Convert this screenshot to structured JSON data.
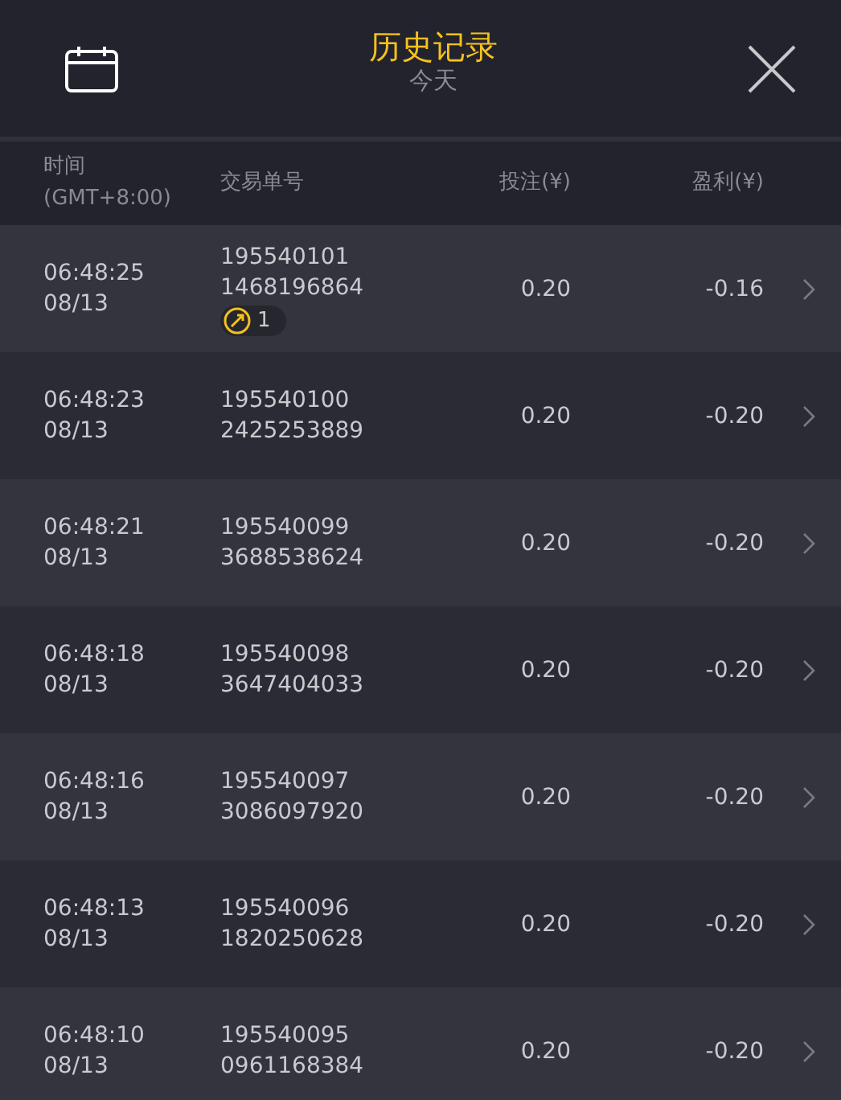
{
  "header": {
    "title": "历史记录",
    "subtitle": "今天"
  },
  "columns": [
    {
      "label": "时间",
      "sublabel": "(GMT+8:00)"
    },
    {
      "label": "交易单号"
    },
    {
      "label": "投注(¥)"
    },
    {
      "label": "盈利(¥)"
    }
  ],
  "rows": [
    {
      "time": "06:48:25",
      "date": "08/13",
      "order_id": "195540101",
      "ref": "1468196864",
      "badge": {
        "count": "1"
      },
      "stake": "0.20",
      "profit": "-0.16"
    },
    {
      "time": "06:48:23",
      "date": "08/13",
      "order_id": "195540100",
      "ref": "2425253889",
      "stake": "0.20",
      "profit": "-0.20"
    },
    {
      "time": "06:48:21",
      "date": "08/13",
      "order_id": "195540099",
      "ref": "3688538624",
      "stake": "0.20",
      "profit": "-0.20"
    },
    {
      "time": "06:48:18",
      "date": "08/13",
      "order_id": "195540098",
      "ref": "3647404033",
      "stake": "0.20",
      "profit": "-0.20"
    },
    {
      "time": "06:48:16",
      "date": "08/13",
      "order_id": "195540097",
      "ref": "3086097920",
      "stake": "0.20",
      "profit": "-0.20"
    },
    {
      "time": "06:48:13",
      "date": "08/13",
      "order_id": "195540096",
      "ref": "1820250628",
      "stake": "0.20",
      "profit": "-0.20"
    },
    {
      "time": "06:48:10",
      "date": "08/13",
      "order_id": "195540095",
      "ref": "0961168384",
      "stake": "0.20",
      "profit": "-0.20"
    }
  ]
}
